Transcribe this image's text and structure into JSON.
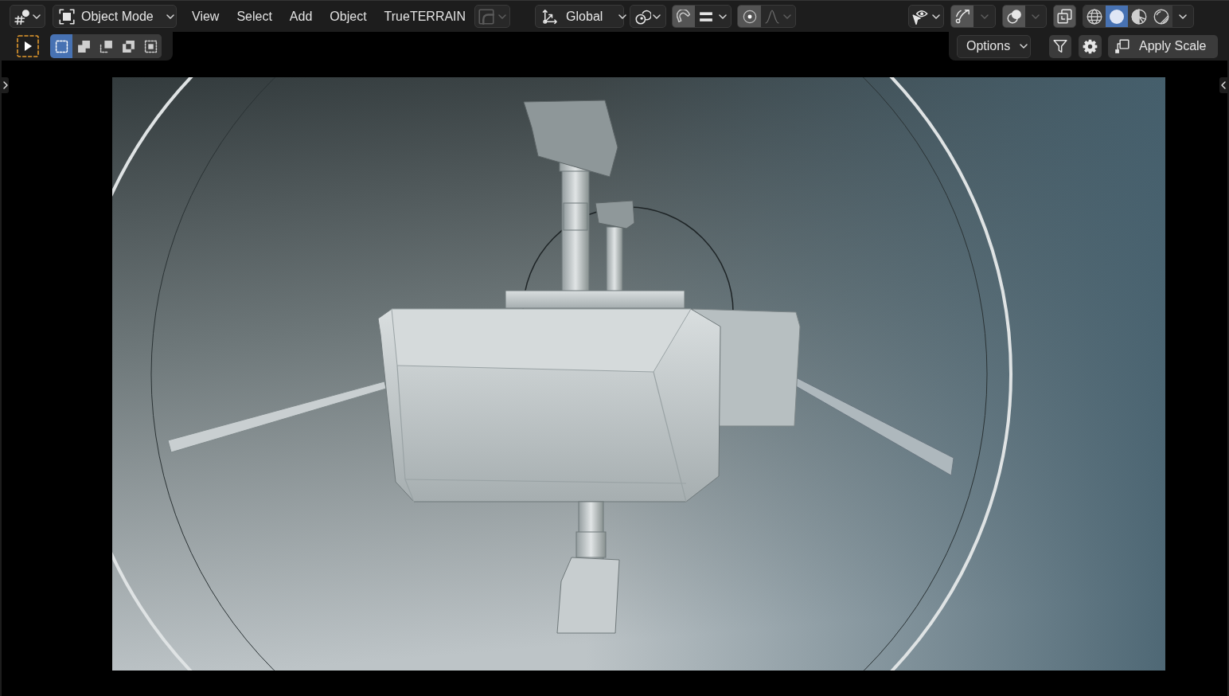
{
  "header": {
    "mode_dropdown": {
      "label": "Object Mode"
    },
    "menus": [
      "View",
      "Select",
      "Add",
      "Object",
      "TrueTERRAIN"
    ],
    "curve_dropdown": {
      "disabled": true
    },
    "orientation_dropdown": {
      "label": "Global"
    },
    "snap": {
      "on": true
    },
    "proportional_editing": {
      "on": true
    },
    "gizmos": {
      "on": true
    },
    "overlays": {
      "on": true
    },
    "xray": {
      "on": true
    },
    "shading_modes": [
      {
        "kind": "wireframe",
        "selected": false
      },
      {
        "kind": "solid",
        "selected": true
      },
      {
        "kind": "material",
        "selected": false
      },
      {
        "kind": "rendered",
        "selected": false
      }
    ]
  },
  "tool_settings": {
    "select_modes": [
      {
        "kind": "set",
        "selected": true
      },
      {
        "kind": "extend",
        "selected": false
      },
      {
        "kind": "subtract",
        "selected": false
      },
      {
        "kind": "difference",
        "selected": false
      },
      {
        "kind": "intersect",
        "selected": false
      }
    ],
    "options_dropdown": {
      "label": "Options"
    },
    "apply_scale_button": {
      "label": "Apply Scale"
    }
  }
}
